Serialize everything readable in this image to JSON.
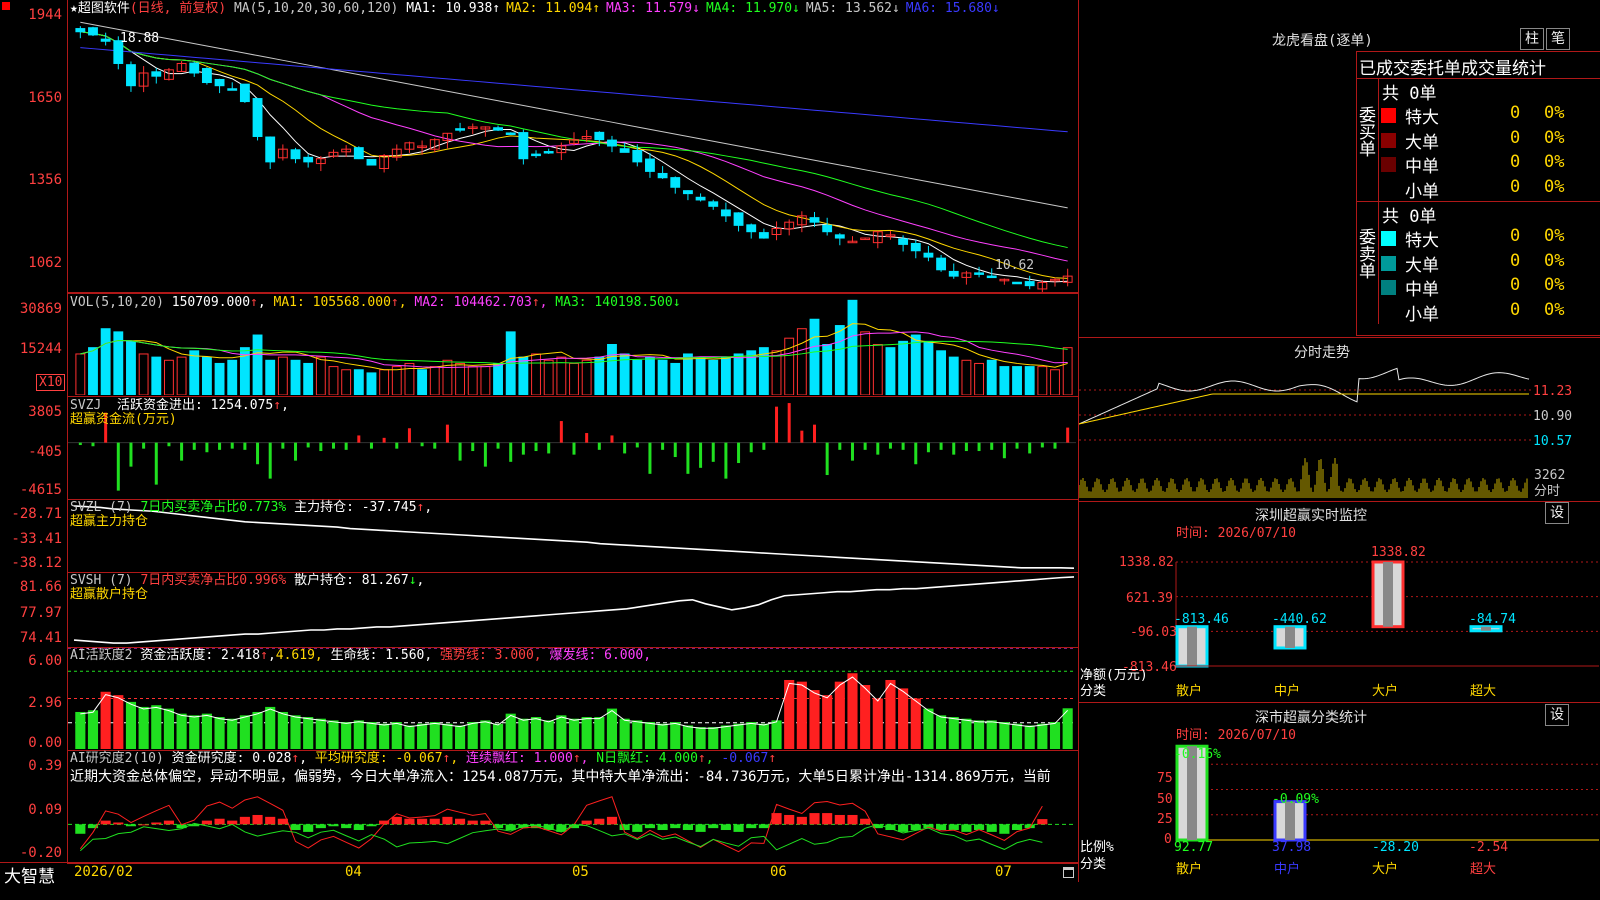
{
  "header": {
    "star": "★",
    "stock_name": "超图软件",
    "period": "(日线, 前复权)",
    "ma_params": "MA(5,10,20,30,60,120)",
    "ma_values": [
      {
        "label": "MA1:",
        "value": "10.938",
        "arrow": "↑",
        "color": "#ffffff"
      },
      {
        "label": "MA2:",
        "value": "11.094",
        "arrow": "↑",
        "color": "#ffd700"
      },
      {
        "label": "MA3:",
        "value": "11.579",
        "arrow": "↓",
        "color": "#ff40ff"
      },
      {
        "label": "MA4:",
        "value": "11.970",
        "arrow": "↓",
        "color": "#20ff20"
      },
      {
        "label": "MA5:",
        "value": "13.562",
        "arrow": "↓",
        "color": "#c8c8c8"
      },
      {
        "label": "MA6:",
        "value": "15.680",
        "arrow": "↓",
        "color": "#3a3aff"
      }
    ]
  },
  "price_panel": {
    "y_labels": [
      "1944",
      "1650",
      "1356",
      "1062"
    ],
    "high_marker": "18.88",
    "low_marker": "10.62"
  },
  "vol_panel": {
    "title": "VOL(5,10,20)",
    "value": "150709.000",
    "ma1": "MA1: 105568.000",
    "ma2": "MA2: 104462.703",
    "ma3": "MA3: 140198.500",
    "y_labels": [
      "30869",
      "15244"
    ],
    "unit": "X10"
  },
  "svzj_panel": {
    "title": "SVZJ",
    "text": "活跃资金进出: 1254.075",
    "sub": "超赢资金流(万元)",
    "y_labels": [
      "3805",
      "-405",
      "-4615"
    ]
  },
  "svzl_panel": {
    "title": "SVZL (7)",
    "text1": "7日内买卖净占比0.773%",
    "text2": "主力持仓: -37.745",
    "sub": "超赢主力持仓",
    "y_labels": [
      "-28.71",
      "-33.41",
      "-38.12"
    ]
  },
  "svsh_panel": {
    "title": "SVSH (7)",
    "text1": "7日内买卖净占比0.996%",
    "text2": "散户持仓: 81.267",
    "sub": "超赢散户持仓",
    "y_labels": [
      "81.66",
      "77.97",
      "74.41"
    ]
  },
  "ai_active_panel": {
    "title": "AI活跃度2",
    "t1": "资金活跃度: 2.418",
    "t2": "4.619,",
    "t3": "生命线: 1.560,",
    "t4": "强势线: 3.000,",
    "t5": "爆发线: 6.000,",
    "y_labels": [
      "6.00",
      "2.96",
      "0.00"
    ]
  },
  "ai_research_panel": {
    "title": "AI研究度2(10)",
    "t1": "资金研究度: 0.028",
    "t2": "平均研究度: -0.067",
    "t3": "连续飘红: 1.000",
    "t4": "N日飘红: 4.000",
    "t5": "-0.067",
    "commentary": "近期大资金总体偏空，异动不明显，偏弱势，今日大单净流入：1254.087万元，其中特大单净流出：-84.736万元，大单5日累计净出-1314.869万元，当前",
    "y_labels": [
      "0.39",
      "0.09",
      "-0.20"
    ]
  },
  "x_axis": {
    "brand": "大智慧",
    "labels": [
      "2026/02",
      "04",
      "05",
      "06",
      "07"
    ]
  },
  "dragon_tiger": {
    "title": "龙虎看盘(逐单)",
    "btn1": "柱",
    "btn2": "笔",
    "subtitle": "已成交委托单成交量统计",
    "buy_label": "委买单",
    "sell_label": "委卖单",
    "buy_total": "共 0单",
    "sell_total": "共 0单",
    "buy_rows": [
      {
        "name": "特大",
        "count": "0",
        "pct": "0%",
        "color": "#ff0000"
      },
      {
        "name": "大单",
        "count": "0",
        "pct": "0%",
        "color": "#8b0000"
      },
      {
        "name": "中单",
        "count": "0",
        "pct": "0%",
        "color": "#6a0000"
      },
      {
        "name": "小单",
        "count": "0",
        "pct": "0%",
        "color": ""
      }
    ],
    "sell_rows": [
      {
        "name": "特大",
        "count": "0",
        "pct": "0%",
        "color": "#00ffff"
      },
      {
        "name": "大单",
        "count": "0",
        "pct": "0%",
        "color": "#009a9a"
      },
      {
        "name": "中单",
        "count": "0",
        "pct": "0%",
        "color": "#008080"
      },
      {
        "name": "小单",
        "count": "0",
        "pct": "0%",
        "color": ""
      }
    ]
  },
  "intraday": {
    "title": "分时走势",
    "y_labels": [
      "11.23",
      "10.90",
      "10.57"
    ],
    "vol_label": "3262",
    "unit": "分时"
  },
  "sz_monitor": {
    "title": "深圳超赢实时监控",
    "btn": "设",
    "time": "时间: 2026/07/10",
    "y_labels": [
      "1338.82",
      "621.39",
      "-96.03",
      "-813.46"
    ],
    "net_label": "净额(万元)",
    "cat_label": "分类",
    "categories": [
      "散户",
      "中户",
      "大户",
      "超大"
    ],
    "values": [
      "-813.46",
      "-440.62",
      "1338.82",
      "-84.74"
    ]
  },
  "sz_classify": {
    "title": "深市超赢分类统计",
    "btn": "设",
    "time": "时间: 2026/07/10",
    "y_labels": [
      "75",
      "50",
      "25",
      "0"
    ],
    "ratio_label": "比例%",
    "cat_label": "分类",
    "categories": [
      "散户",
      "中户",
      "大户",
      "超大"
    ],
    "bottom_values": [
      "92.77",
      "37.98",
      "-28.20",
      "-2.54"
    ],
    "top_values": [
      "-0.16%",
      "-0.09%"
    ]
  },
  "chart_data": [
    {
      "type": "candlestick",
      "title": "超图软件 (日线, 前复权)",
      "ylim": [
        10.4,
        19.6
      ],
      "x_labels": [
        "2026/02",
        "04",
        "05",
        "06",
        "07"
      ],
      "close": [
        18.6,
        18.5,
        18.3,
        17.6,
        16.9,
        17.3,
        17.2,
        17.4,
        17.6,
        17.3,
        17.0,
        16.9,
        16.8,
        16.4,
        15.3,
        14.5,
        14.9,
        14.6,
        14.5,
        14.6,
        14.8,
        14.9,
        14.6,
        14.4,
        14.7,
        14.9,
        15.1,
        15.0,
        15.2,
        15.4,
        15.5,
        15.6,
        15.6,
        15.5,
        15.4,
        14.6,
        14.7,
        14.8,
        15.0,
        15.2,
        15.3,
        15.2,
        15.0,
        14.8,
        14.5,
        14.2,
        14.0,
        13.7,
        13.5,
        13.3,
        13.1,
        12.8,
        12.5,
        12.3,
        12.1,
        12.4,
        12.6,
        12.8,
        12.6,
        12.3,
        12.1,
        12.0,
        12.1,
        12.3,
        12.2,
        11.9,
        11.7,
        11.5,
        11.1,
        10.9,
        11.0,
        11.0,
        10.9,
        10.8,
        10.7,
        10.6,
        10.7,
        10.8,
        10.9
      ],
      "highlights": {
        "high": "18.88",
        "low": "10.62"
      },
      "series": [
        {
          "name": "MA1",
          "last": "10.938"
        },
        {
          "name": "MA2",
          "last": "11.094"
        },
        {
          "name": "MA3",
          "last": "11.579"
        },
        {
          "name": "MA4",
          "last": "11.970"
        },
        {
          "name": "MA5",
          "last": "13.562"
        },
        {
          "name": "MA6",
          "last": "15.680"
        }
      ]
    },
    {
      "type": "bar",
      "title": "VOL(5,10,20)",
      "ylim": [
        0,
        32000
      ],
      "values": [
        13000,
        15000,
        21000,
        20000,
        17000,
        13000,
        12000,
        11000,
        12000,
        14000,
        12000,
        10000,
        11000,
        15000,
        19000,
        11000,
        12000,
        11000,
        10000,
        12000,
        9000,
        8000,
        8000,
        7000,
        8000,
        9000,
        10000,
        8000,
        9000,
        11000,
        10000,
        9000,
        9000,
        10000,
        20000,
        12000,
        13000,
        11000,
        12000,
        10000,
        11000,
        12000,
        16000,
        13000,
        11000,
        12000,
        11000,
        10000,
        13000,
        12000,
        11000,
        12000,
        13000,
        14000,
        15000,
        14000,
        18000,
        21000,
        24000,
        16000,
        22000,
        30000,
        20000,
        16000,
        15000,
        17000,
        19000,
        17000,
        14000,
        12000,
        11000,
        10000,
        11000,
        9000,
        9000,
        9000,
        9000,
        8000,
        15000
      ]
    },
    {
      "type": "bar",
      "title": "SVZJ 活跃资金进出",
      "ylim": [
        -4615,
        3805
      ],
      "values": [
        -200,
        -300,
        2500,
        -4000,
        -2000,
        -500,
        -3500,
        -300,
        -1500,
        -600,
        -800,
        -600,
        -500,
        -600,
        -1800,
        -3000,
        -500,
        -1500,
        -400,
        -700,
        -500,
        -600,
        600,
        -500,
        400,
        -500,
        1200,
        -300,
        -500,
        1500,
        -1500,
        -700,
        -2000,
        -500,
        -1600,
        -1000,
        -700,
        -900,
        1800,
        -1000,
        800,
        -600,
        600,
        -900,
        -400,
        -2600,
        -600,
        -1200,
        -2600,
        -2100,
        -1600,
        -3000,
        -1700,
        -800,
        -600,
        3000,
        3300,
        1000,
        1500,
        -2700,
        -600,
        -1500,
        -600,
        -1000,
        -500,
        -600,
        -1800,
        -800,
        -600,
        -1000,
        -700,
        -700,
        -600,
        -1300,
        -500,
        -900,
        -400,
        -500,
        1254
      ]
    },
    {
      "type": "line",
      "title": "SVZL 主力持仓",
      "ylim": [
        -38.12,
        -28.71
      ],
      "values": [
        -29.5,
        -29.6,
        -29.7,
        -29.9,
        -30.0,
        -30.1,
        -30.2,
        -30.4,
        -30.6,
        -30.8,
        -31.0,
        -31.2,
        -31.4,
        -31.6,
        -31.7,
        -31.8,
        -31.9,
        -32.0,
        -32.1,
        -32.2,
        -32.3,
        -32.5,
        -32.6,
        -32.7,
        -32.8,
        -32.9,
        -33.0,
        -33.1,
        -33.2,
        -33.3,
        -33.4,
        -33.5,
        -33.6,
        -33.7,
        -33.8,
        -33.9,
        -34.0,
        -34.1,
        -34.2,
        -34.3,
        -34.5,
        -34.6,
        -34.7,
        -34.8,
        -34.9,
        -35.0,
        -35.1,
        -35.2,
        -35.3,
        -35.4,
        -35.5,
        -35.6,
        -35.7,
        -35.8,
        -35.9,
        -36.0,
        -36.1,
        -36.2,
        -36.3,
        -36.4,
        -36.5,
        -36.6,
        -36.7,
        -36.8,
        -36.9,
        -37.0,
        -37.1,
        -37.2,
        -37.3,
        -37.4,
        -37.5,
        -37.6,
        -37.7,
        -37.7,
        -37.7,
        -37.7,
        -37.745
      ]
    },
    {
      "type": "line",
      "title": "SVSH 散户持仓",
      "ylim": [
        74.41,
        81.66
      ],
      "values": [
        75.0,
        74.9,
        74.8,
        74.7,
        74.7,
        74.8,
        74.9,
        75.0,
        75.1,
        75.2,
        75.3,
        75.4,
        75.5,
        75.6,
        75.6,
        75.7,
        75.8,
        75.9,
        76.0,
        76.0,
        76.1,
        76.1,
        76.2,
        76.3,
        76.3,
        76.4,
        76.5,
        76.6,
        76.7,
        76.8,
        76.9,
        77.0,
        77.1,
        77.2,
        77.3,
        77.4,
        77.5,
        77.6,
        77.7,
        77.8,
        77.9,
        78.0,
        78.1,
        78.3,
        78.5,
        78.7,
        78.9,
        79.0,
        78.6,
        78.3,
        78.0,
        78.2,
        78.5,
        79.0,
        79.4,
        79.5,
        79.6,
        79.7,
        79.8,
        79.8,
        79.9,
        80.0,
        80.0,
        80.1,
        80.1,
        80.2,
        80.3,
        80.4,
        80.5,
        80.6,
        80.7,
        80.8,
        80.9,
        81.0,
        81.1,
        81.2,
        81.267
      ]
    },
    {
      "type": "bar",
      "title": "AI活跃度2",
      "ylim": [
        0,
        6.0
      ],
      "values": [
        2.2,
        2.3,
        3.4,
        3.2,
        2.8,
        2.5,
        2.6,
        2.4,
        2.1,
        2.0,
        2.1,
        1.9,
        1.8,
        2.0,
        2.2,
        2.5,
        2.2,
        2.0,
        1.9,
        1.8,
        1.7,
        1.6,
        1.7,
        1.6,
        1.5,
        1.6,
        1.4,
        1.5,
        1.6,
        1.5,
        1.4,
        1.6,
        1.7,
        1.5,
        2.1,
        1.8,
        1.9,
        1.7,
        2.0,
        1.8,
        1.9,
        1.9,
        2.4,
        1.8,
        1.7,
        1.6,
        1.5,
        1.6,
        1.4,
        1.3,
        1.3,
        1.4,
        1.5,
        1.6,
        1.5,
        1.7,
        4.1,
        4.0,
        3.5,
        3.2,
        4.0,
        4.5,
        3.8,
        3.0,
        4.1,
        3.6,
        3.0,
        2.4,
        2.0,
        1.9,
        1.8,
        1.7,
        1.7,
        1.6,
        1.5,
        1.4,
        1.5,
        1.6,
        2.418
      ],
      "lines": {
        "生命线": 1.56,
        "强势线": 3.0,
        "爆发线": 6.0
      }
    },
    {
      "type": "bar",
      "title": "AI研究度2(10)",
      "ylim": [
        -0.2,
        0.39
      ],
      "values": [
        -0.05,
        -0.02,
        0.02,
        0.01,
        -0.01,
        0.0,
        0.01,
        0.02,
        -0.02,
        -0.01,
        0.02,
        0.03,
        0.02,
        0.04,
        0.05,
        0.04,
        0.03,
        -0.03,
        -0.04,
        -0.02,
        -0.01,
        -0.02,
        -0.03,
        -0.01,
        0.02,
        0.04,
        0.03,
        0.03,
        0.03,
        0.04,
        0.03,
        0.02,
        0.02,
        -0.02,
        -0.03,
        -0.02,
        -0.02,
        -0.03,
        -0.04,
        -0.02,
        0.02,
        0.03,
        0.04,
        -0.03,
        -0.04,
        -0.02,
        -0.03,
        -0.02,
        -0.03,
        -0.04,
        -0.02,
        -0.03,
        -0.04,
        -0.02,
        -0.02,
        0.06,
        0.05,
        0.04,
        0.06,
        0.06,
        0.05,
        0.05,
        0.03,
        -0.02,
        -0.03,
        -0.04,
        -0.03,
        -0.02,
        -0.03,
        -0.03,
        -0.04,
        -0.03,
        -0.04,
        -0.05,
        -0.03,
        -0.02,
        0.028
      ]
    }
  ]
}
